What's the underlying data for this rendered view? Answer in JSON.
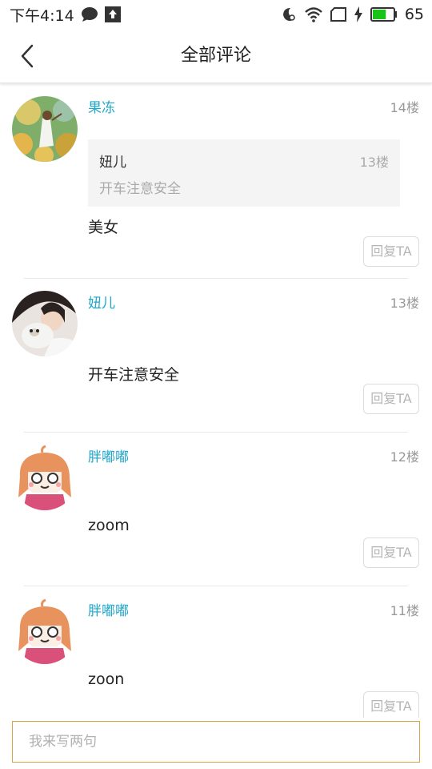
{
  "status_bar": {
    "time": "下午4:14",
    "battery": "65",
    "icons": [
      "chat-bubble-icon",
      "upload-icon",
      "night-mode-icon",
      "wifi-icon",
      "sim-icon",
      "charging-icon",
      "battery-icon"
    ],
    "battery_color": "#19c419"
  },
  "header": {
    "title": "全部评论",
    "back_icon": "chevron-left-icon"
  },
  "colors": {
    "username": "#1fa8c9",
    "input_border": "#d8a54a"
  },
  "comments": [
    {
      "user": "果冻",
      "floor": "14楼",
      "avatar": "painting-avatar",
      "quote": {
        "user": "妞儿",
        "floor": "13楼",
        "text": "开车注意安全"
      },
      "text": "美女",
      "reply_label": "回复TA"
    },
    {
      "user": "妞儿",
      "floor": "13楼",
      "avatar": "girl-with-puppy-avatar",
      "text": "开车注意安全",
      "reply_label": "回复TA"
    },
    {
      "user": "胖嘟嘟",
      "floor": "12楼",
      "avatar": "cartoon-girl-avatar",
      "text": "zoom",
      "reply_label": "回复TA"
    },
    {
      "user": "胖嘟嘟",
      "floor": "11楼",
      "avatar": "cartoon-girl-avatar",
      "text": "zoon",
      "reply_label": "回复TA"
    }
  ],
  "input": {
    "placeholder": "我来写两句",
    "value": ""
  }
}
